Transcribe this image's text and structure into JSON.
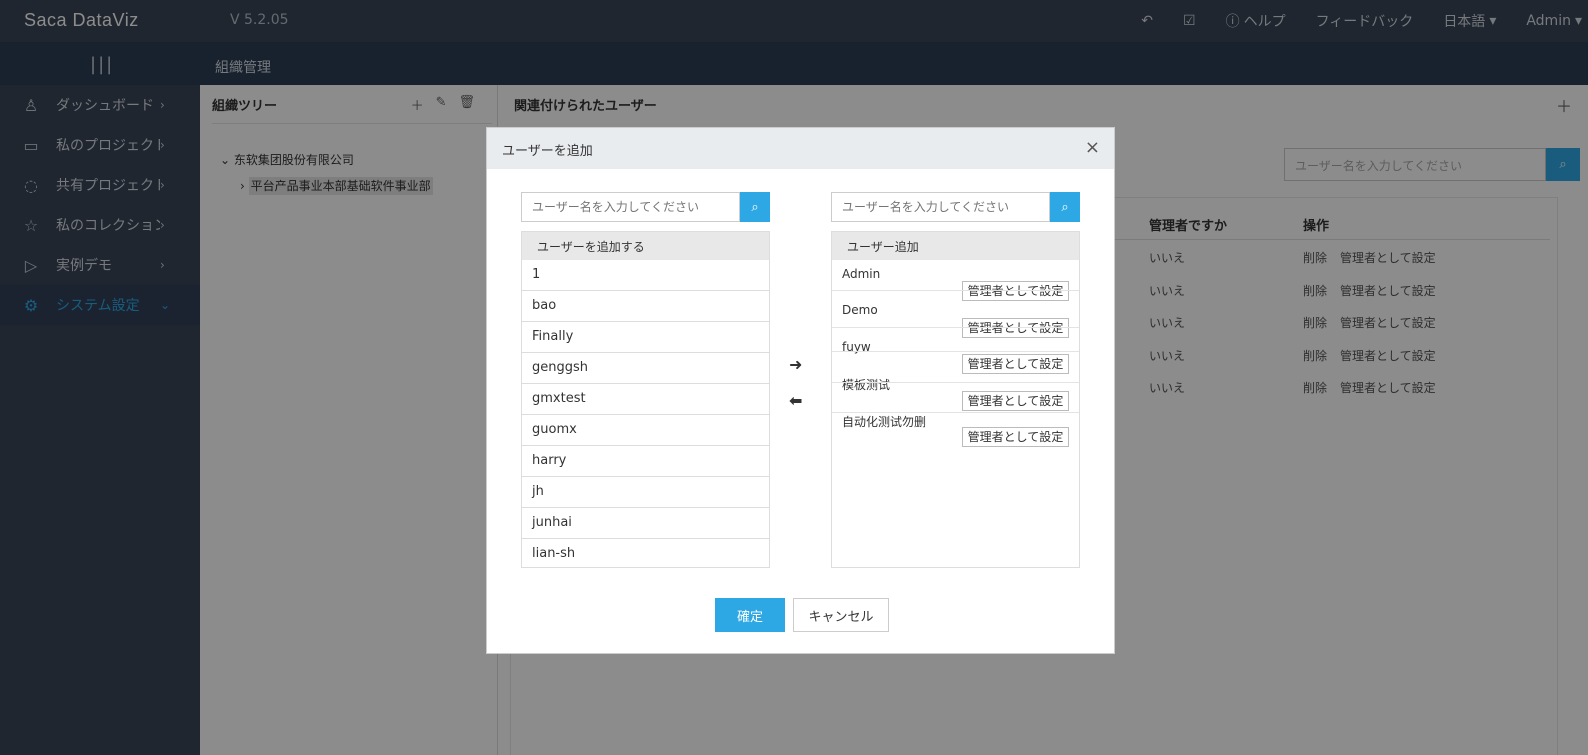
{
  "header": {
    "logo": "Saca DataViz",
    "version": "V 5.2.05",
    "help": "ヘルプ",
    "feedback": "フィードバック",
    "language": "日本語",
    "user": "Admin"
  },
  "breadcrumb": "組織管理",
  "sidebar": {
    "items": [
      {
        "label": "ダッシュボード",
        "icon": "user-icon"
      },
      {
        "label": "私のプロジェクト",
        "icon": "monitor-icon"
      },
      {
        "label": "共有プロジェクト",
        "icon": "share-icon"
      },
      {
        "label": "私のコレクション",
        "icon": "star-icon"
      },
      {
        "label": "実例デモ",
        "icon": "play-icon"
      },
      {
        "label": "システム設定",
        "icon": "gear-icon",
        "active": true
      }
    ]
  },
  "tree": {
    "title": "組織ツリー",
    "nodes": [
      "东软集团股份有限公司",
      "平台产品事业本部基础软件事业部"
    ]
  },
  "users_panel": {
    "title": "関連付けられたユーザー",
    "search_placeholder": "ユーザー名を入力してください",
    "columns": {
      "admin": "管理者ですか",
      "ops": "操作"
    },
    "rows": [
      {
        "admin": "いいえ",
        "delete": "削除",
        "set_admin": "管理者として設定"
      },
      {
        "admin": "いいえ",
        "delete": "削除",
        "set_admin": "管理者として設定"
      },
      {
        "admin": "いいえ",
        "delete": "削除",
        "set_admin": "管理者として設定"
      },
      {
        "admin": "いいえ",
        "delete": "削除",
        "set_admin": "管理者として設定"
      },
      {
        "admin": "いいえ",
        "delete": "削除",
        "set_admin": "管理者として設定"
      }
    ]
  },
  "modal": {
    "title": "ユーザーを追加",
    "left": {
      "search_placeholder": "ユーザー名を入力してください",
      "header": "ユーザーを追加する",
      "items": [
        "1",
        "bao",
        "Finally",
        "genggsh",
        "gmxtest",
        "guomx",
        "harry",
        "jh",
        "junhai",
        "lian-sh"
      ]
    },
    "right": {
      "search_placeholder": "ユーザー名を入力してください",
      "header": "ユーザー追加",
      "set_admin_label": "管理者として設定",
      "items": [
        "Admin",
        "Demo",
        "fuyw",
        "模板测试",
        "自动化测试勿删"
      ]
    },
    "ok": "確定",
    "cancel": "キャンセル"
  },
  "colors": {
    "accent": "#2ea8e5",
    "topbar": "#394657",
    "sidebar": "#394657"
  }
}
